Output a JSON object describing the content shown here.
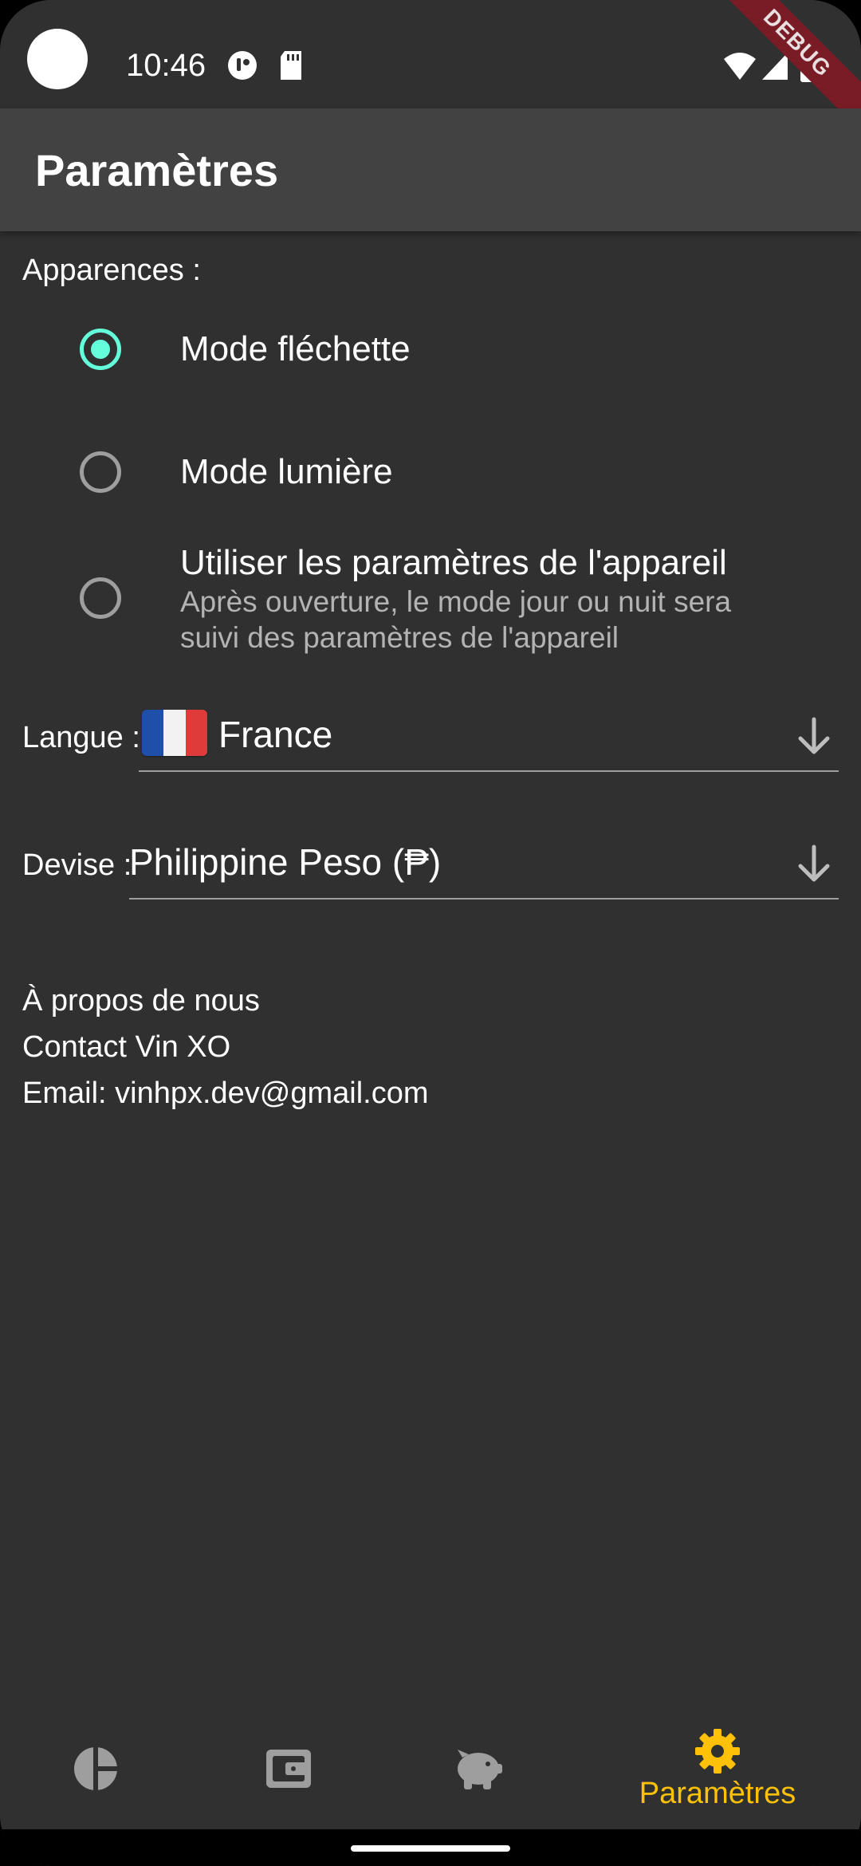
{
  "status_bar": {
    "time": "10:46",
    "debug_label": "DEBUG"
  },
  "app_bar": {
    "title": "Paramètres"
  },
  "appearance": {
    "label": "Apparences :",
    "options": [
      {
        "title": "Mode fléchette",
        "subtitle": "",
        "selected": true
      },
      {
        "title": "Mode lumière",
        "subtitle": "",
        "selected": false
      },
      {
        "title": "Utiliser les paramètres de l'appareil",
        "subtitle": "Après ouverture, le mode jour ou nuit sera suivi des paramètres de l'appareil",
        "selected": false
      }
    ]
  },
  "language": {
    "label": "Langue :",
    "value": "France",
    "flag_colors": [
      "#1f4fa8",
      "#f2f2f2",
      "#e03b3b"
    ]
  },
  "currency": {
    "label": "Devise :",
    "value": "Philippine Peso (₱)"
  },
  "about": {
    "title": "À propos de nous",
    "contact": "Contact Vin XO",
    "email": "Email: vinhpx.dev@gmail.com"
  },
  "bottom_nav": {
    "items": [
      {
        "icon": "pie-chart-icon",
        "label": "",
        "active": false
      },
      {
        "icon": "wallet-icon",
        "label": "",
        "active": false
      },
      {
        "icon": "piggy-bank-icon",
        "label": "",
        "active": false
      },
      {
        "icon": "gear-icon",
        "label": "Paramètres",
        "active": true
      }
    ]
  },
  "colors": {
    "background": "#303030",
    "app_bar": "#424242",
    "accent_radio": "#64ffda",
    "active_nav": "#ffc107",
    "inactive_nav": "#9e9e9e"
  }
}
